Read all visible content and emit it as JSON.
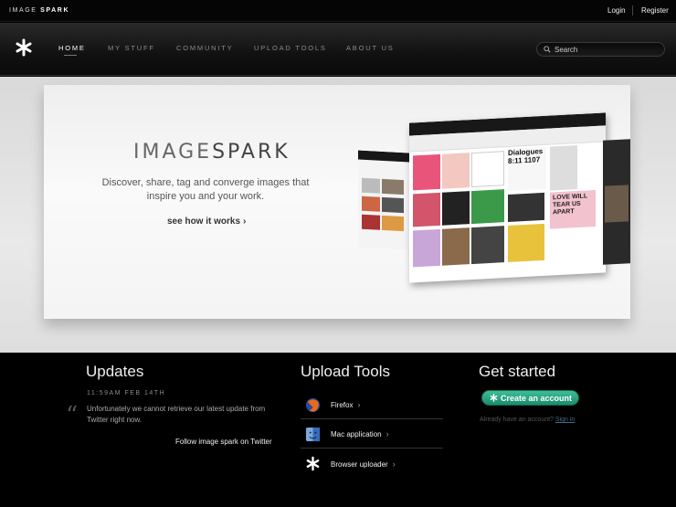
{
  "topbar": {
    "brand_light": "IMAGE",
    "brand_bold": "SPARK",
    "login": "Login",
    "register": "Register"
  },
  "nav": {
    "items": [
      "HOME",
      "MY STUFF",
      "COMMUNITY",
      "UPLOAD TOOLS",
      "ABOUT US"
    ],
    "active": "HOME",
    "search_placeholder": "Search"
  },
  "hero": {
    "title_light": "IMAGE",
    "title_bold": "SPARK",
    "tagline": "Discover, share, tag and converge images that inspire you and your work.",
    "cta": "see how it works",
    "cta_chevron": "›",
    "showcase_headline": "Dialogues 8:11 1107",
    "showcase_poster": "LOVE WILL TEAR US APART"
  },
  "updates": {
    "title": "Updates",
    "timestamp": "11:59AM FEB 14TH",
    "quote": "“",
    "message": "Unfortunately we cannot retrieve our latest update from Twitter right now.",
    "follow": "Follow image spark on Twitter"
  },
  "upload_tools": {
    "title": "Upload Tools",
    "chevron": "›",
    "items": [
      {
        "label": "Firefox",
        "icon": "firefox-icon"
      },
      {
        "label": "Mac application",
        "icon": "mac-finder-icon"
      },
      {
        "label": "Browser uploader",
        "icon": "spark-star-icon"
      }
    ]
  },
  "get_started": {
    "title": "Get started",
    "button": "Create an account",
    "already": "Already have an account?",
    "signin": "Sign in"
  },
  "colors": {
    "accent_green": "#2aa882",
    "background": "#000000",
    "hero_bg": "#e4e4e4"
  }
}
